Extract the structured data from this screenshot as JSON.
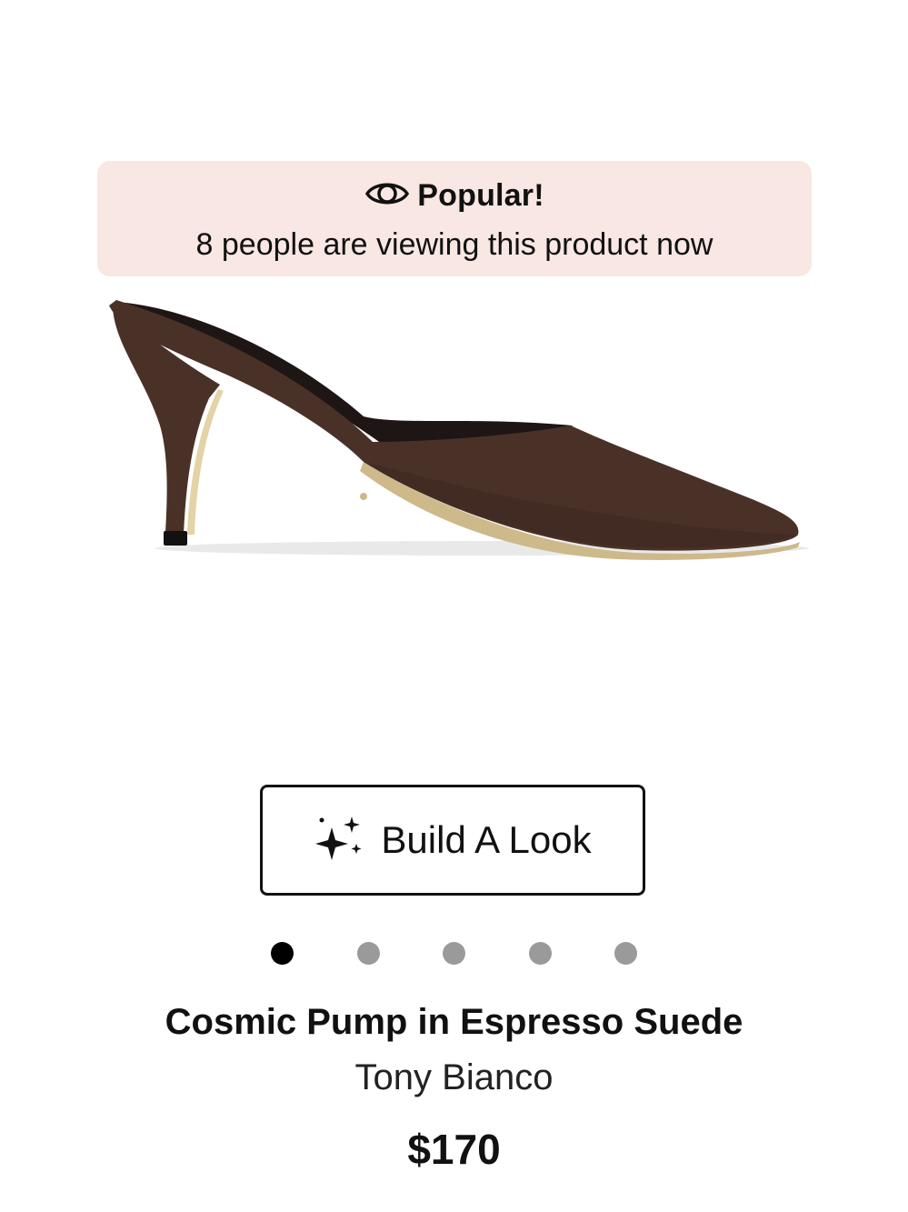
{
  "popular_banner": {
    "icon": "eye-icon",
    "title": "Popular!",
    "message": "8 people are viewing this product now",
    "background": "#f8e7e2"
  },
  "product_image": {
    "alt": "Cosmic Pump in Espresso Suede",
    "suede_color": "#4a3128"
  },
  "build_look": {
    "icon": "sparkles-icon",
    "label": "Build A Look"
  },
  "carousel": {
    "slide_count": 5,
    "active_index": 0
  },
  "product": {
    "name": "Cosmic Pump in Espresso Suede",
    "brand": "Tony Bianco",
    "price": "$170"
  }
}
